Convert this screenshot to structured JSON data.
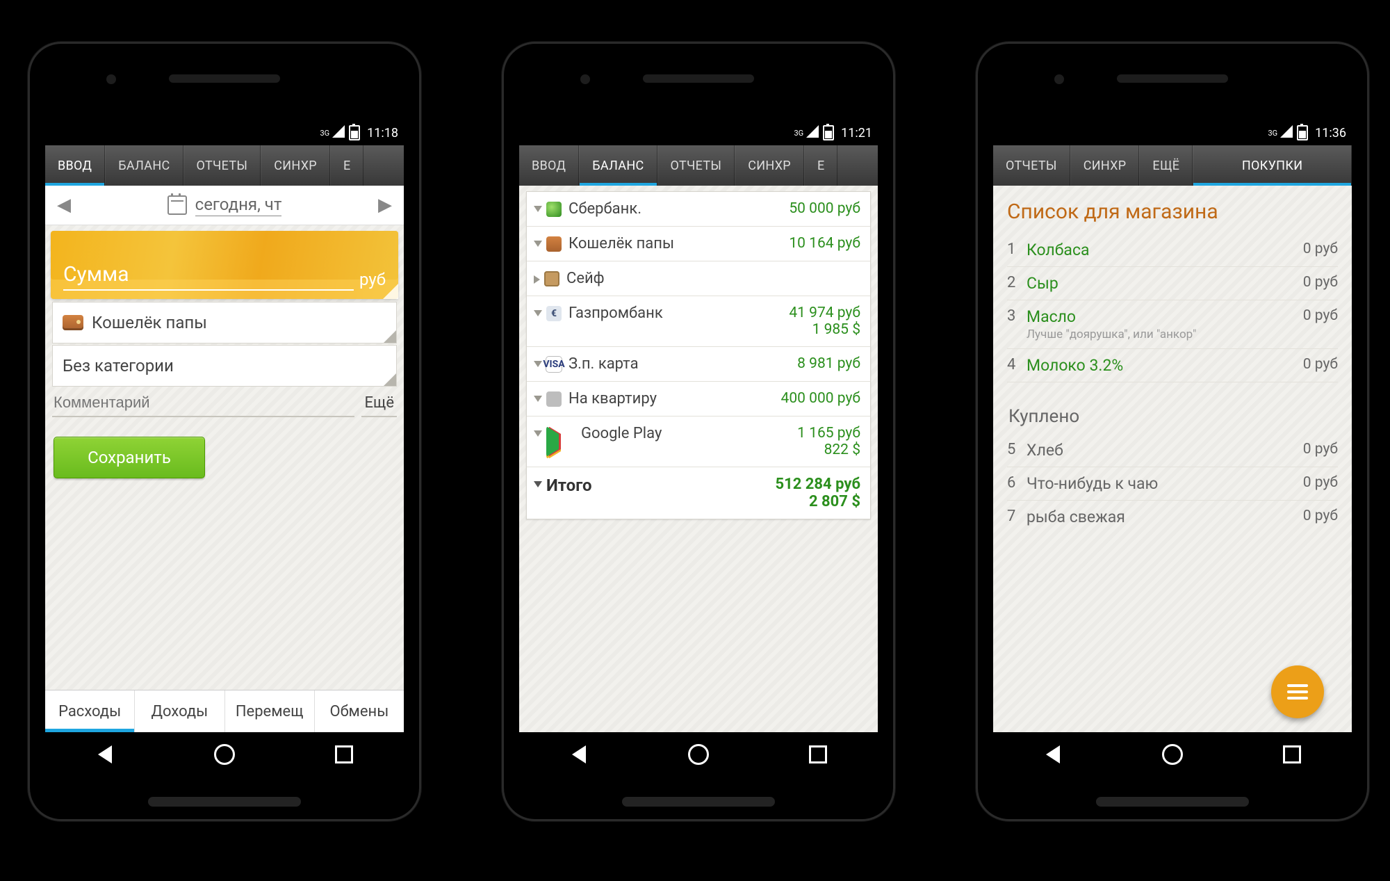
{
  "phones": [
    {
      "status_time": "11:18",
      "signal_label": "3G",
      "tabs": [
        "ВВОД",
        "БАЛАНС",
        "ОТЧЕТЫ",
        "СИНХР",
        "Е"
      ],
      "active_tab": "ВВОД",
      "date": {
        "label": "сегодня, чт"
      },
      "amount": {
        "label": "Сумма",
        "currency": "руб"
      },
      "account": {
        "label": "Кошелёк папы"
      },
      "category": {
        "label": "Без категории"
      },
      "comment": {
        "placeholder": "Комментарий",
        "more": "Ещё"
      },
      "save_btn": "Сохранить",
      "bottom_tabs": [
        "Расходы",
        "Доходы",
        "Перемещ",
        "Обмены"
      ],
      "bottom_active": "Расходы"
    },
    {
      "status_time": "11:21",
      "signal_label": "3G",
      "tabs": [
        "ВВОД",
        "БАЛАНС",
        "ОТЧЕТЫ",
        "СИНХР",
        "Е"
      ],
      "active_tab": "БАЛАНС",
      "accounts": [
        {
          "icon": "acc-sber",
          "name": "Сбербанк.",
          "lines": [
            "50 000  руб"
          ],
          "caret": "down"
        },
        {
          "icon": "acc-wallet",
          "name": "Кошелёк папы",
          "lines": [
            "10 164  руб"
          ],
          "caret": "down"
        },
        {
          "icon": "acc-safe",
          "name": "Сейф",
          "lines": [],
          "caret": "right"
        },
        {
          "icon": "acc-gpb",
          "name": "Газпромбанк",
          "lines": [
            "41 974  руб",
            "1 985  $"
          ],
          "caret": "down"
        },
        {
          "icon": "acc-visa",
          "name": "З.п. карта",
          "lines": [
            "8 981  руб"
          ],
          "caret": "down"
        },
        {
          "icon": "acc-home",
          "name": "На квартиру",
          "lines": [
            "400 000  руб"
          ],
          "caret": "down"
        },
        {
          "icon": "acc-play",
          "name": "Google Play",
          "lines": [
            "1 165  руб",
            "822  $"
          ],
          "caret": "down"
        }
      ],
      "total": {
        "name": "Итого",
        "lines": [
          "512 284  руб",
          "2 807  $"
        ]
      }
    },
    {
      "status_time": "11:36",
      "signal_label": "3G",
      "tabs": [
        "ОТЧЕТЫ",
        "СИНХР",
        "ЕЩЁ",
        "ПОКУПКИ"
      ],
      "active_tab": "ПОКУПКИ",
      "heading": "Список для магазина",
      "to_buy": [
        {
          "n": "1",
          "title": "Колбаса",
          "price": "0  руб"
        },
        {
          "n": "2",
          "title": "Сыр",
          "price": "0  руб"
        },
        {
          "n": "3",
          "title": "Масло",
          "sub": "Лучше \"доярушка\", или \"анкор\"",
          "price": "0  руб"
        },
        {
          "n": "4",
          "title": "Молоко 3.2%",
          "price": "0  руб"
        }
      ],
      "bought_heading": "Куплено",
      "bought": [
        {
          "n": "5",
          "title": "Хлеб",
          "price": "0  руб"
        },
        {
          "n": "6",
          "title": "Что-нибудь к чаю",
          "price": "0  руб"
        },
        {
          "n": "7",
          "title": "рыба свежая",
          "price": "0  руб"
        }
      ]
    }
  ]
}
